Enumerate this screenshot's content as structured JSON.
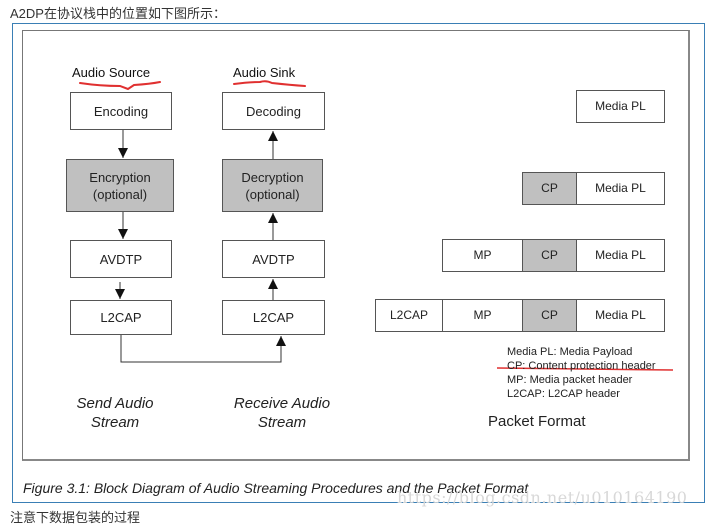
{
  "intro_text": "A2DP在协议栈中的位置如下图所示：",
  "outro_text": "注意下数据包装的过程",
  "figure": {
    "send_column": {
      "header": "Audio Source",
      "blocks": [
        {
          "label": "Encoding",
          "optional": false
        },
        {
          "label": "Encryption\n(optional)",
          "line1": "Encryption",
          "line2": "(optional)",
          "optional": true
        },
        {
          "label": "AVDTP",
          "optional": false
        },
        {
          "label": "L2CAP",
          "optional": false
        }
      ],
      "footer_line1": "Send Audio",
      "footer_line2": "Stream"
    },
    "receive_column": {
      "header": "Audio Sink",
      "blocks": [
        {
          "label": "Decoding",
          "optional": false
        },
        {
          "label": "Decryption\n(optional)",
          "line1": "Decryption",
          "line2": "(optional)",
          "optional": true
        },
        {
          "label": "AVDTP",
          "optional": false
        },
        {
          "label": "L2CAP",
          "optional": false
        }
      ],
      "footer_line1": "Receive Audio",
      "footer_line2": "Stream"
    },
    "packet_rows": [
      [
        "Media PL"
      ],
      [
        "CP",
        "Media PL"
      ],
      [
        "MP",
        "CP",
        "Media PL"
      ],
      [
        "L2CAP",
        "MP",
        "CP",
        "Media PL"
      ]
    ],
    "legend": [
      "Media PL: Media Payload",
      "CP: Content protection header",
      "MP: Media packet header",
      "L2CAP: L2CAP header"
    ],
    "packet_title": "Packet Format",
    "caption": "Figure 3.1: Block Diagram of Audio Streaming Procedures and the Packet Format"
  },
  "watermark": "https://blog.csdn.net/u010164190",
  "colors": {
    "frame_border": "#3a7fb5",
    "optional_fill": "#c0c0c0",
    "annotation_red": "#e03030"
  }
}
